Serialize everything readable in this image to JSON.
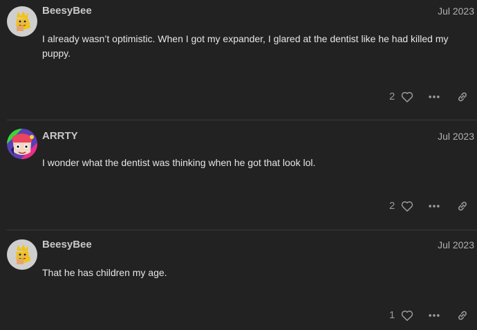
{
  "posts": [
    {
      "username": "BeesyBee",
      "date": "Jul 2023",
      "body": "I already wasn’t optimistic. When I got my expander, I glared at the dentist like he had killed my puppy.",
      "likes": "2",
      "avatar_icon": "bee-avatar-icon"
    },
    {
      "username": "ARRTY",
      "date": "Jul 2023",
      "body": "I wonder what the dentist was thinking when he got that look lol.",
      "likes": "2",
      "avatar_icon": "cartoon-avatar-icon"
    },
    {
      "username": "BeesyBee",
      "date": "Jul 2023",
      "body": "That he has children my age.",
      "likes": "1",
      "avatar_icon": "bee-avatar-icon"
    }
  ],
  "colors": {
    "background": "#222222",
    "text": "#e6e6e6",
    "muted": "#9a9a9a"
  }
}
